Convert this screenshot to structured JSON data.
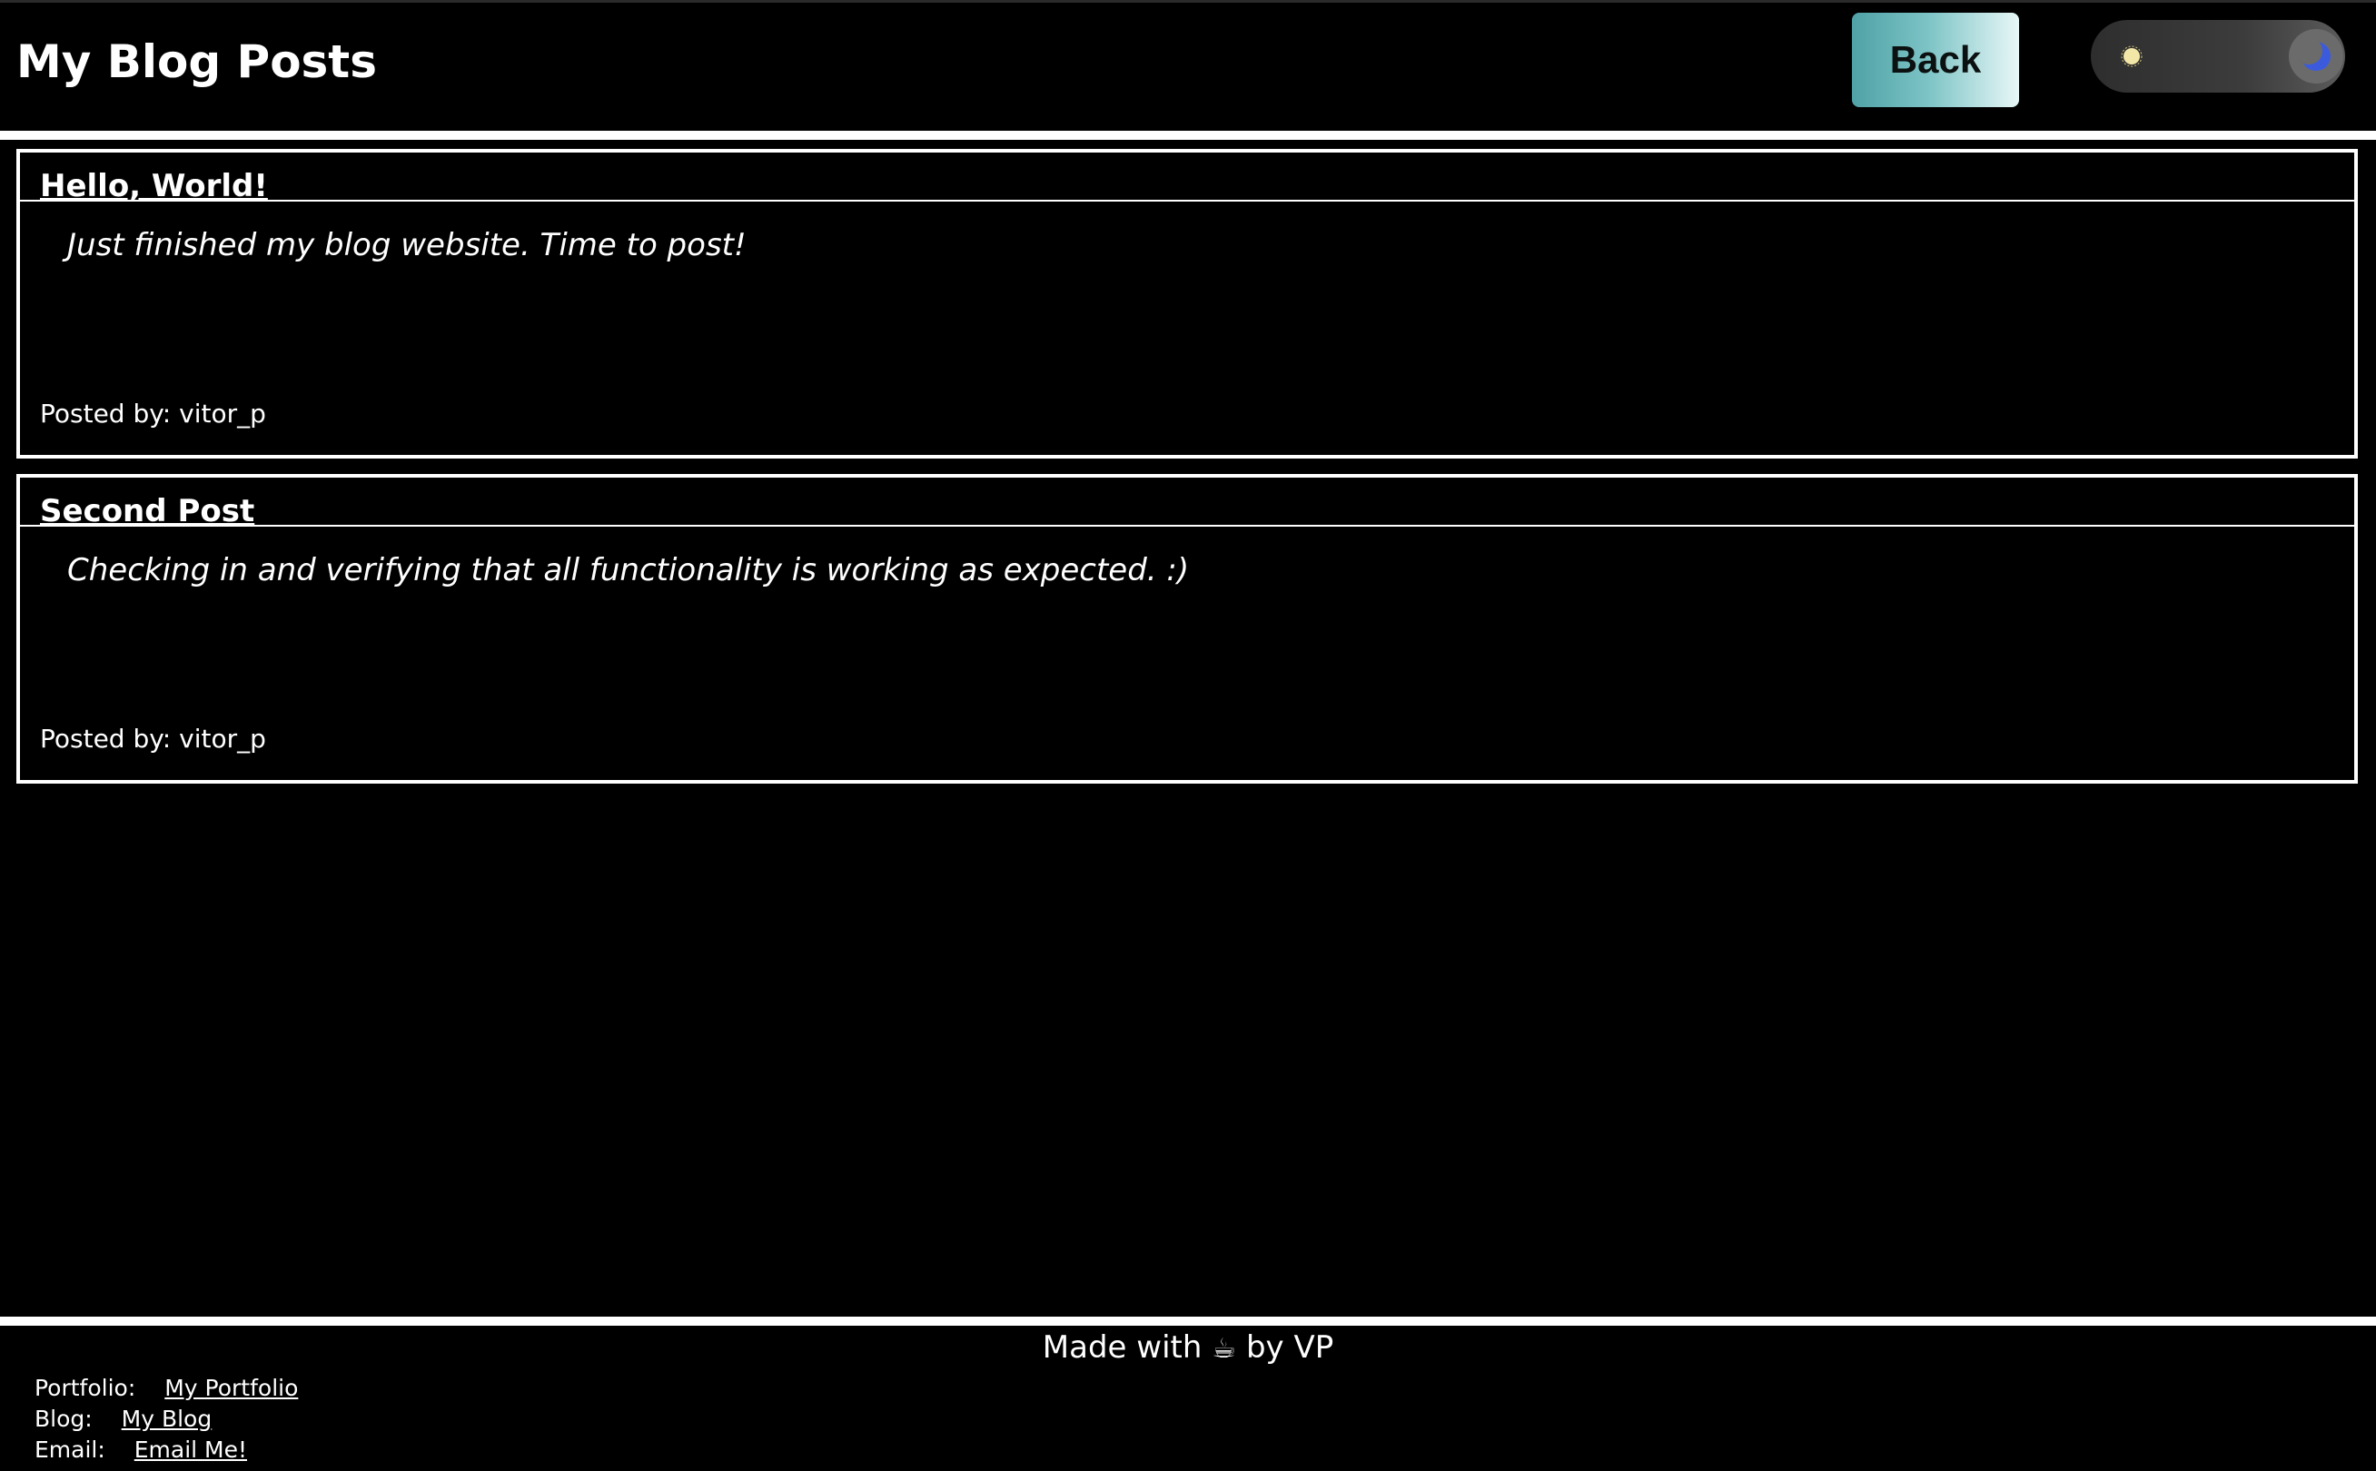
{
  "header": {
    "title": "My Blog Posts",
    "back_label": "Back",
    "theme_toggle": {
      "state": "dark",
      "icons": [
        "sun-icon",
        "moon-icon"
      ]
    }
  },
  "posts": [
    {
      "title": "Hello, World!",
      "body": "Just finished my blog website. Time to post!",
      "author": "Posted by: vitor_p"
    },
    {
      "title": "Second Post",
      "body": "Checking in and verifying that all functionality is working as expected. :)",
      "author": "Posted by: vitor_p"
    }
  ],
  "footer": {
    "made_with_prefix": "Made with",
    "made_with_icon": "☕",
    "made_with_suffix": "by VP",
    "links": [
      {
        "label": "Portfolio:",
        "link_text": "My Portfolio"
      },
      {
        "label": "Blog:",
        "link_text": "My Blog"
      },
      {
        "label": "Email:",
        "link_text": "Email Me!"
      }
    ]
  },
  "colors": {
    "background": "#000000",
    "text": "#ffffff",
    "back_button_gradient": [
      "#4fa2a6",
      "#e8f7f7"
    ],
    "toggle_track": "#3c3c3c",
    "moon": "#3b5bdc",
    "sun": "#f3e7a8"
  }
}
